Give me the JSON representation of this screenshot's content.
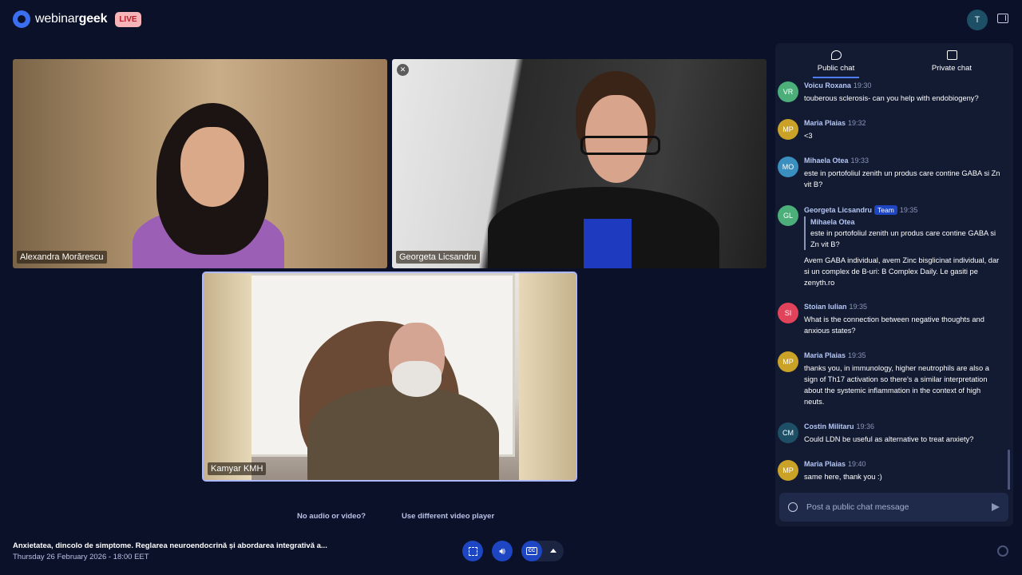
{
  "header": {
    "brand_light": "webinar",
    "brand_bold": "geek",
    "live_label": "LIVE",
    "user_initial": "T"
  },
  "tiles": [
    {
      "name": "Alexandra Morărescu",
      "muted": false
    },
    {
      "name": "Georgeta Licsandru",
      "muted": true
    },
    {
      "name": "Kamyar KMH",
      "muted": false,
      "speaking": true
    }
  ],
  "video_links": {
    "no_av": "No audio or video?",
    "other_player": "Use different video player"
  },
  "footer": {
    "title": "Anxietatea, dincolo de simptome. Reglarea neuroendocrină și abordarea integrativă a...",
    "date": "Thursday 26 February 2026 - 18:00 EET",
    "cc_label": "CC"
  },
  "chat": {
    "tabs": [
      {
        "label": "Public chat",
        "active": true
      },
      {
        "label": "Private chat",
        "active": false
      }
    ],
    "messages": [
      {
        "initials": "VR",
        "color": "#4caf7a",
        "name": "Voicu Roxana",
        "time": "19:30",
        "text": "touberous sclerosis- can you help with endobiogeny?"
      },
      {
        "initials": "MP",
        "color": "#c9a227",
        "name": "Maria Plaias",
        "time": "19:32",
        "text": "<3"
      },
      {
        "initials": "MO",
        "color": "#3a8fbf",
        "name": "Mihaela Otea",
        "time": "19:33",
        "text": "este in portofoliul zenith un produs care contine GABA si Zn vit B?"
      },
      {
        "initials": "GL",
        "color": "#4caf7a",
        "name": "Georgeta Licsandru",
        "badge": "Team",
        "time": "19:35",
        "quote_name": "Mihaela Otea",
        "quote_text": "este in portofoliul zenith un produs care contine GABA si Zn vit B?",
        "text": "Avem GABA individual, avem Zinc bisglicinat individual, dar si un complex de B-uri: B Complex Daily. Le gasiti pe zenyth.ro"
      },
      {
        "initials": "SI",
        "color": "#e0435a",
        "name": "Stoian Iulian",
        "time": "19:35",
        "text": "What is the connection between negative thoughts and anxious states?"
      },
      {
        "initials": "MP",
        "color": "#c9a227",
        "name": "Maria Plaias",
        "time": "19:35",
        "text": "thanks you, in immunology, higher neutrophils are also a sign of Th17 activation so there's a similar interpretation about the systemic inflammation in the context of high neuts."
      },
      {
        "initials": "CM",
        "color": "#1d4f66",
        "name": "Costin Militaru",
        "time": "19:36",
        "text": "Could LDN be useful as alternative to treat anxiety?"
      },
      {
        "initials": "MP",
        "color": "#c9a227",
        "name": "Maria Plaias",
        "time": "19:40",
        "text": "same here, thank you :)"
      }
    ],
    "composer_placeholder": "Post a public chat message"
  }
}
